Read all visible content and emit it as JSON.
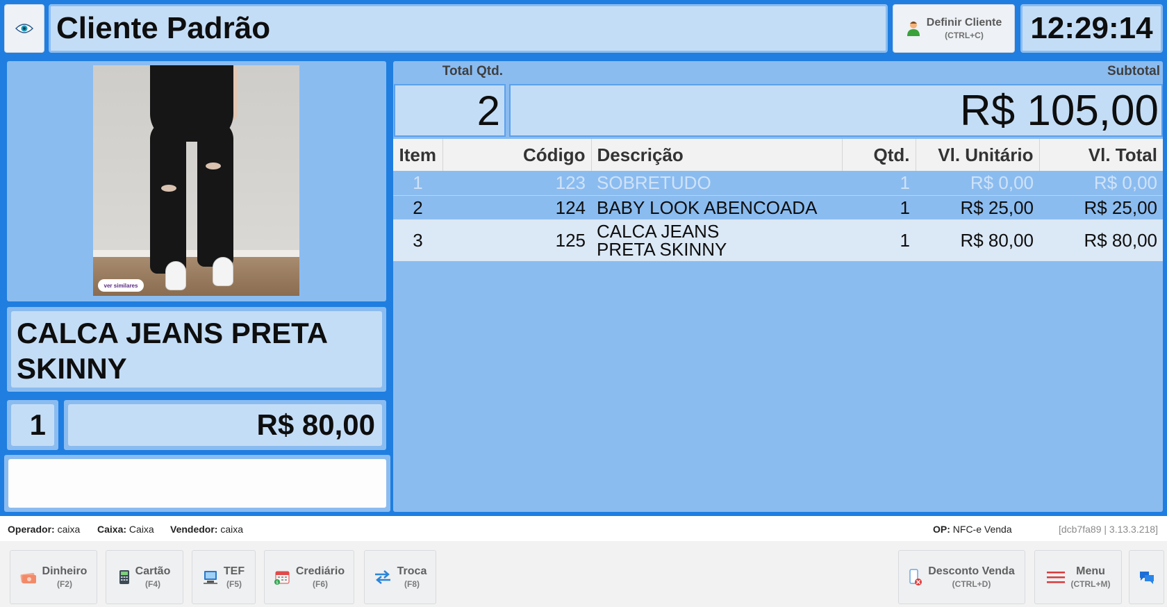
{
  "header": {
    "client_name": "Cliente Padrão",
    "define_client": {
      "label": "Definir Cliente",
      "shortcut": "(CTRL+C)"
    },
    "clock": "12:29:14"
  },
  "product": {
    "image_badge": "ver similares",
    "name": "CALCA JEANS PRETA SKINNY",
    "quantity": "1",
    "price": "R$ 80,00"
  },
  "barcode": {
    "value": ""
  },
  "totals": {
    "qty_label": "Total Qtd.",
    "qty_value": "2",
    "subtotal_label": "Subtotal",
    "subtotal_value": "R$ 105,00"
  },
  "table": {
    "headers": [
      "Item",
      "Código",
      "Descrição",
      "Qtd.",
      "Vl. Unitário",
      "Vl. Total"
    ],
    "rows": [
      {
        "item": "1",
        "code": "123",
        "description": "SOBRETUDO",
        "qty": "1",
        "unit": "R$ 0,00",
        "total": "R$ 0,00"
      },
      {
        "item": "2",
        "code": "124",
        "description": "BABY LOOK ABENCOADA",
        "qty": "1",
        "unit": "R$ 25,00",
        "total": "R$ 25,00"
      },
      {
        "item": "3",
        "code": "125",
        "description": "CALCA JEANS PRETA SKINNY",
        "qty": "1",
        "unit": "R$ 80,00",
        "total": "R$ 80,00"
      }
    ]
  },
  "status": {
    "operator_label": "Operador:",
    "operator": "caixa",
    "cashier_label": "Caixa:",
    "cashier": "Caixa",
    "seller_label": "Vendedor:",
    "seller": "caixa",
    "op_label": "OP:",
    "op": "NFC-e Venda",
    "version": "[dcb7fa89 | 3.13.3.218]"
  },
  "footer": {
    "dinheiro": {
      "label": "Dinheiro",
      "shortcut": "(F2)"
    },
    "cartao": {
      "label": "Cartão",
      "shortcut": "(F4)"
    },
    "tef": {
      "label": "TEF",
      "shortcut": "(F5)"
    },
    "crediario": {
      "label": "Crediário",
      "shortcut": "(F6)"
    },
    "troca": {
      "label": "Troca",
      "shortcut": "(F8)"
    },
    "desconto": {
      "label": "Desconto Venda",
      "shortcut": "(CTRL+D)"
    },
    "menu": {
      "label": "Menu",
      "shortcut": "(CTRL+M)"
    }
  },
  "colors": {
    "app_background": "#1f7ee0",
    "panel": "#8bbcf0",
    "field": "#c4ddf6",
    "light_row": "#dbe8f5"
  }
}
